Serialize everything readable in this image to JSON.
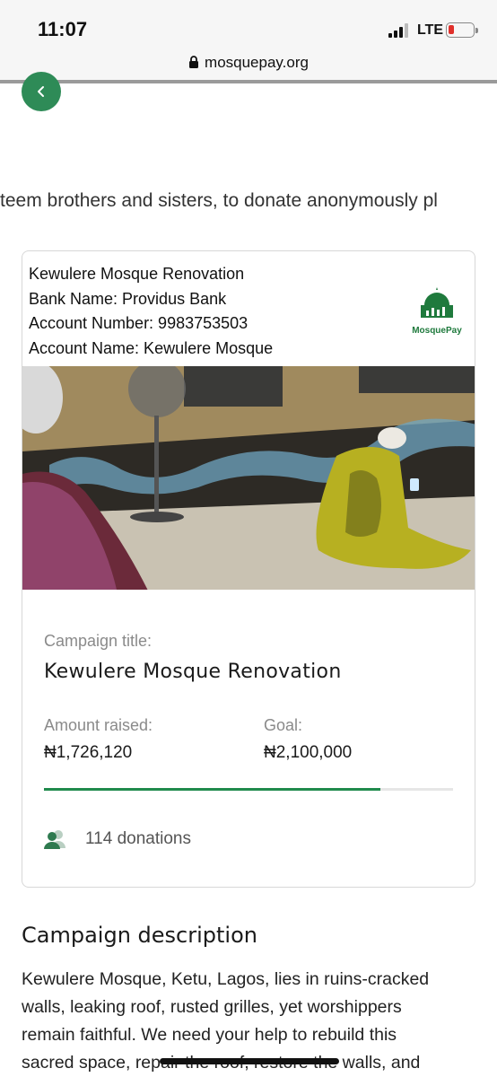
{
  "status_bar": {
    "time": "11:07",
    "network": "LTE"
  },
  "browser": {
    "url": "mosquepay.org"
  },
  "intro_text": "teem brothers and sisters, to donate anonymously pl",
  "card": {
    "bank_info": {
      "campaign": "Kewulere Mosque Renovation",
      "bank_name": "Bank Name: Providus Bank",
      "account_number": "Account Number: 9983753503",
      "account_name": "Account Name: Kewulere Mosque"
    },
    "logo_text": "MosquePay",
    "campaign_title_label": "Campaign title:",
    "campaign_title": "Kewulere Mosque Renovation",
    "amount_raised_label": "Amount raised:",
    "amount_raised": "₦1,726,120",
    "goal_label": "Goal:",
    "goal": "₦2,100,000",
    "progress_fraction": 0.822,
    "donations": "114 donations"
  },
  "description": {
    "heading": "Campaign description",
    "lines": [
      "Kewulere Mosque, Ketu, Lagos, lies in ruins-cracked",
      "walls, leaking roof, rusted grilles, yet worshippers",
      "remain faithful. We need your help to rebuild this",
      "sacred space, repair the roof, restore the walls, and"
    ]
  },
  "colors": {
    "brand_green": "#2e8b57",
    "progress_green": "#1f8a4c"
  },
  "icons": [
    "lock-icon",
    "chevron-left-icon",
    "mosque-logo-icon",
    "users-icon"
  ]
}
